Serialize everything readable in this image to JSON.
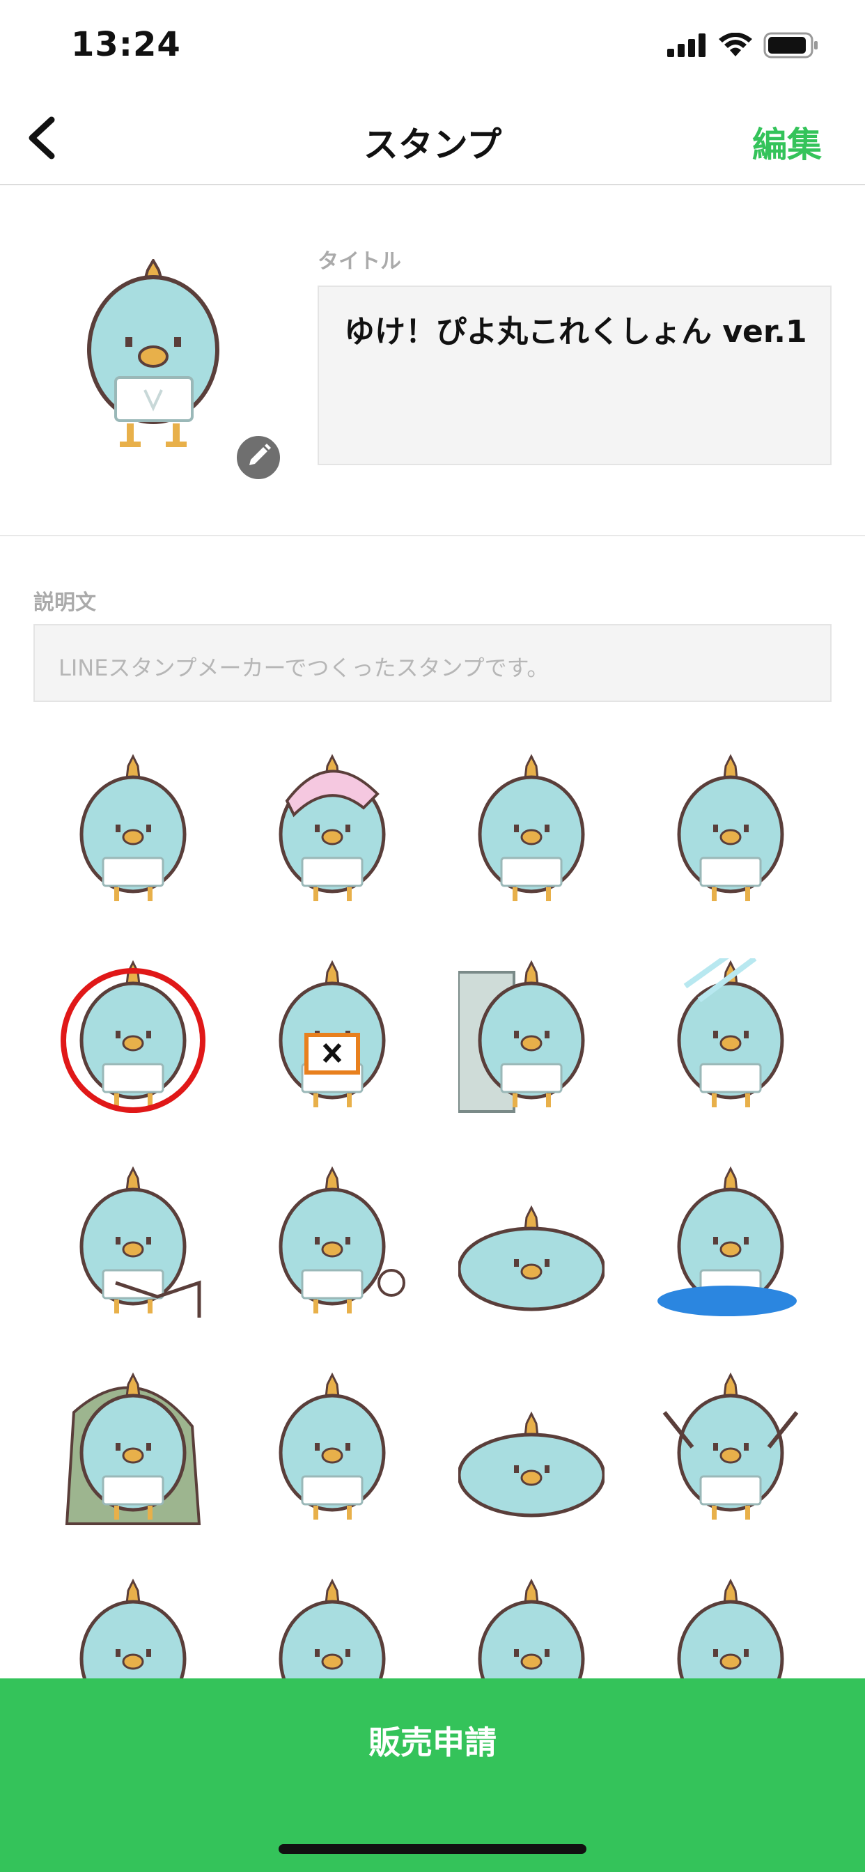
{
  "status_bar": {
    "time": "13:24"
  },
  "nav": {
    "title": "スタンプ",
    "edit_label": "編集",
    "back_icon": "chevron-left-icon"
  },
  "main_sticker": {
    "icon": "pencil-icon"
  },
  "title_field": {
    "label": "タイトル",
    "value": "ゆけ！ぴよ丸これくしょん ver.1"
  },
  "description_field": {
    "label": "説明文",
    "placeholder": "LINEスタンプメーカーでつくったスタンプです。"
  },
  "sticker_grid": {
    "columns": 4,
    "rows_visible": 5,
    "stickers": [
      "towel-wiping",
      "sleep-cap",
      "standing",
      "waving",
      "circle-ok",
      "x-sign",
      "peeking-wall",
      "window-glare",
      "fishing-swing",
      "kick-puff",
      "flattened",
      "crying-puddle",
      "hooded-cloak",
      "hugging-ball",
      "lying-down",
      "cheer-pompoms",
      "flower",
      "surprised",
      "smile",
      "teary"
    ]
  },
  "sell_button": {
    "label": "販売申請"
  },
  "colors": {
    "accent": "#34c35a",
    "bird": "#a8dde0",
    "outline": "#5a3e3a",
    "beak": "#e8b04a"
  }
}
